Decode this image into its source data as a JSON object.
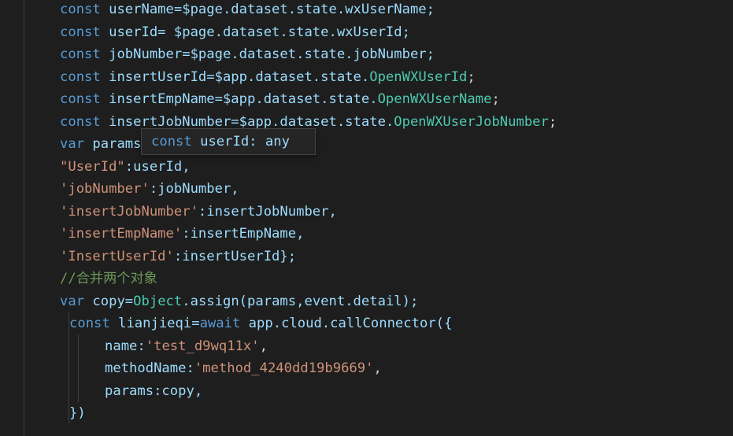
{
  "code": {
    "l1": {
      "kw": "const ",
      "ident": "userName=$page.dataset.state.wxUserName;"
    },
    "l2": {
      "kw": "const ",
      "ident": "userId= $page.dataset.state.wxUserId;"
    },
    "l3": {
      "kw": "const ",
      "ident": "jobNumber=$page.dataset.state.jobNumber;"
    },
    "l4": {
      "kw": "const ",
      "ident": "insertUserId=$app.dataset.state.",
      "prop": "OpenWXUserId",
      "end": ";"
    },
    "l5": {
      "kw": "const ",
      "ident": "insertEmpName=$app.dataset.state.",
      "prop": "OpenWXUserName",
      "end": ";"
    },
    "l6": {
      "kw": "const ",
      "ident": "insertJobNumber=$app.dataset.state.",
      "prop": "OpenWXUserJobNumber",
      "end": ";"
    },
    "l7": {
      "kw": "var ",
      "ident": "params"
    },
    "l8": {
      "key": "\"UserId\"",
      "rest": ":userId,"
    },
    "l9": {
      "key": "'jobNumber'",
      "rest": ":jobNumber,"
    },
    "l10": {
      "key": "'insertJobNumber'",
      "rest": ":insertJobNumber,"
    },
    "l11": {
      "key": "'insertEmpName'",
      "rest": ":insertEmpName,"
    },
    "l12": {
      "key": "'InsertUserId'",
      "rest": ":insertUserId};"
    },
    "l13": {
      "comment": "//合并两个对象"
    },
    "l14": {
      "kw": "var ",
      "a": "copy=",
      "cls": "Object",
      "b": ".assign(params,event.detail);"
    },
    "l15": {
      "kw": "const ",
      "a": "lianjieqi=",
      "kw2": "await ",
      "b": "app.cloud.callConnector({"
    },
    "l16": {
      "a": "name:",
      "str": "'test_d9wq11x'",
      "b": ","
    },
    "l17": {
      "a": "methodName:",
      "str": "'method_4240dd19b9669'",
      "b": ","
    },
    "l18": {
      "a": "params:copy,"
    },
    "l19": {
      "a": "})"
    }
  },
  "hover": {
    "kw": "const ",
    "text": "userId: any"
  },
  "colors": {
    "background": "#1e1e1e",
    "keyword": "#569cd6",
    "variable": "#9cdcfe",
    "type": "#4ec9b0",
    "string": "#ce9178",
    "comment": "#6a9955"
  }
}
